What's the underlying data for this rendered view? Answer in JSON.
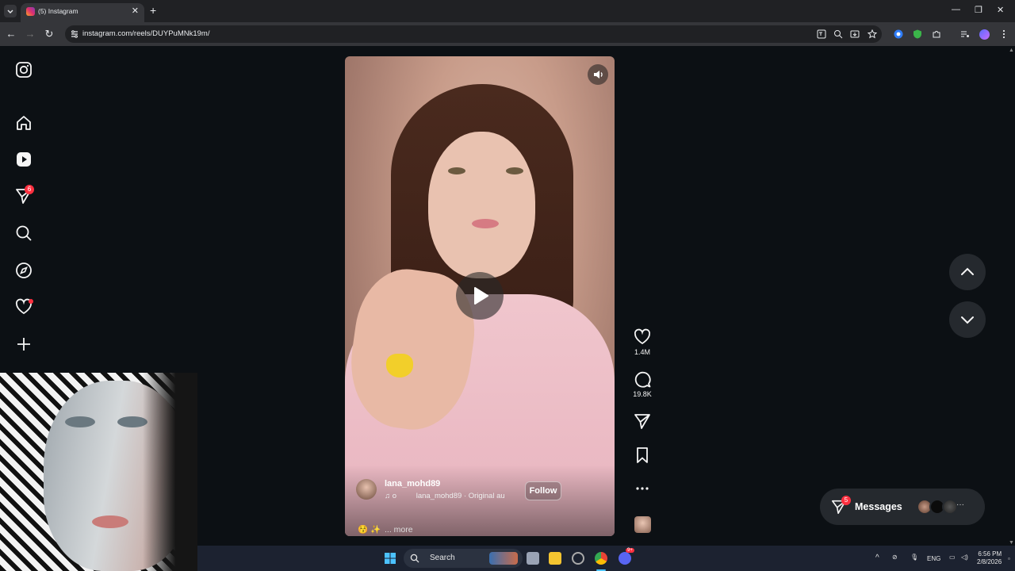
{
  "browser": {
    "tab_title": "(5) Instagram",
    "tab_close": "✕",
    "new_tab": "+",
    "url": "instagram.com/reels/DUYPuMNk19m/",
    "window_controls": [
      "—",
      "❐",
      "✕"
    ],
    "nav": {
      "back": "←",
      "forward": "→",
      "reload": "↻"
    }
  },
  "sidebar": {
    "items": [
      {
        "name": "instagram-logo-icon"
      },
      {
        "name": "home-icon"
      },
      {
        "name": "reels-icon"
      },
      {
        "name": "messages-icon",
        "badge": "6"
      },
      {
        "name": "search-icon"
      },
      {
        "name": "explore-icon"
      },
      {
        "name": "notifications-heart-icon",
        "dot": true
      },
      {
        "name": "create-plus-icon"
      }
    ]
  },
  "reel": {
    "author": "lana_mohd89",
    "audio_prefix": "♫ o",
    "audio": "lana_mohd89 · Original au",
    "follow_label": "Follow",
    "caption_emoji": "😚 ✨",
    "caption_more": "... more",
    "likes": "1.4M",
    "comments": "19.8K"
  },
  "messages": {
    "label": "Messages",
    "badge": "5",
    "more": "···"
  },
  "taskbar": {
    "search_label": "Search",
    "lang": "ENG",
    "time": "6:56 PM",
    "date": "2/8/2026",
    "discord_badge": "9+"
  },
  "colors": {
    "page_bg": "#0c1014",
    "badge_red": "#ff3040",
    "chrome_dark": "#202124",
    "chrome_toolbar": "#35363a"
  }
}
